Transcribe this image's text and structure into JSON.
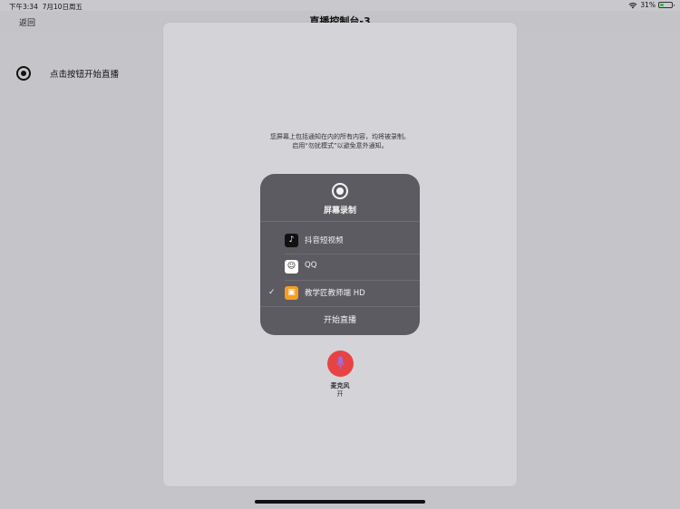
{
  "status_bar": {
    "time": "下午3:34",
    "date": "7月10日周五",
    "battery_percent": "31%",
    "battery_level": 0.31,
    "wifi_icon": "wifi-icon",
    "battery_icon": "battery-icon"
  },
  "nav": {
    "back_label": "返回",
    "title": "直播控制台-3"
  },
  "page": {
    "broadcast_icon": "record-icon",
    "broadcast_label": "点击按钮开始直播"
  },
  "modal": {
    "notice_line1": "您屏幕上包括通知在内的所有内容，均将被录制。",
    "notice_line2": "启用“勿扰模式”以避免意外通知。",
    "picker": {
      "icon": "record-icon",
      "title": "屏幕录制",
      "apps": [
        {
          "name": "抖音短视频",
          "icon": "tiktok-icon",
          "selected": false
        },
        {
          "name": "QQ",
          "icon": "qq-icon",
          "selected": false
        },
        {
          "name": "教学匠教师端 HD",
          "icon": "teacher-app-icon",
          "selected": true
        }
      ],
      "checkmark": "✓",
      "start_label": "开始直播"
    },
    "microphone": {
      "icon": "microphone-icon",
      "label": "麦克风",
      "state": "开",
      "accent_color": "#e84343"
    }
  },
  "colors": {
    "background": "#c5c5c9",
    "sheet": "#d4d4d8",
    "picker_panel": "#5b5b61",
    "teacher_app": "#f59d24"
  }
}
